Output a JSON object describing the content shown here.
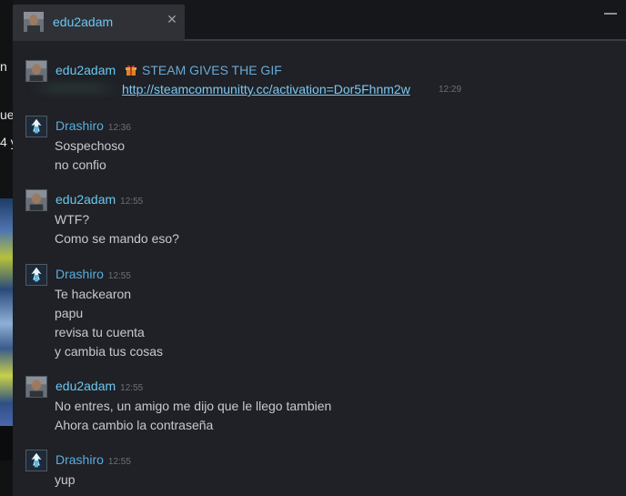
{
  "background": {
    "fragments": [
      "n",
      "ue",
      "4 y"
    ]
  },
  "tab": {
    "name": "edu2adam",
    "close_glyph": "✕"
  },
  "messages": [
    {
      "sender": "edu2adam",
      "gift_title": "STEAM GIVES THE GIF",
      "link": "http://steamcommunitty.cc/activation=Dor5Fhnm2w",
      "time": "12:29"
    },
    {
      "sender": "Drashiro",
      "time": "12:36",
      "lines": [
        "Sospechoso",
        "no confio"
      ]
    },
    {
      "sender": "edu2adam",
      "time": "12:55",
      "lines": [
        "WTF?",
        "Como se mando eso?"
      ]
    },
    {
      "sender": "Drashiro",
      "time": "12:55",
      "lines": [
        "Te hackearon",
        "papu",
        "revisa tu cuenta",
        "y cambia tus cosas"
      ]
    },
    {
      "sender": "edu2adam",
      "time": "12:55",
      "lines": [
        "No entres, un amigo me dijo que le llego tambien",
        "Ahora cambio la contraseña"
      ]
    },
    {
      "sender": "Drashiro",
      "time": "12:55",
      "lines": [
        "yup"
      ]
    }
  ],
  "icons": {
    "gift": "gift-icon",
    "close": "close-icon",
    "minimize": "minimize-icon"
  },
  "colors": {
    "accent_name": "#6bc7f0",
    "link": "#7ec8f2",
    "text": "#c7c9cc",
    "timestamp": "#6b6f75",
    "window_bg": "#1f2126"
  }
}
